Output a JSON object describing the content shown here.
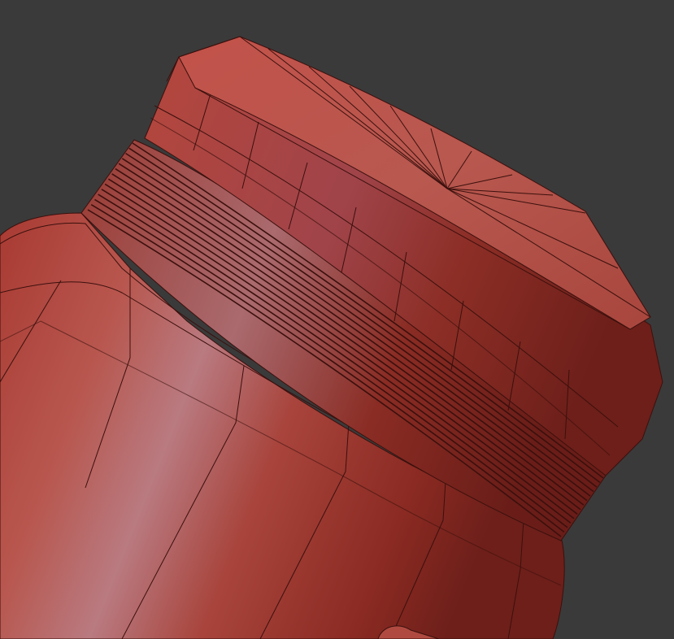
{
  "viewport": {
    "background_color": "#3a3a3a"
  },
  "model": {
    "shape": "bottle-with-threaded-cap",
    "render_mode": "shaded-with-wireframe",
    "base_color": "#b84a3f",
    "highlight_color": "#c98a8e",
    "shadow_color": "#6e1f1a",
    "wire_color": "#3b100d",
    "thread_ring_count": 14
  }
}
